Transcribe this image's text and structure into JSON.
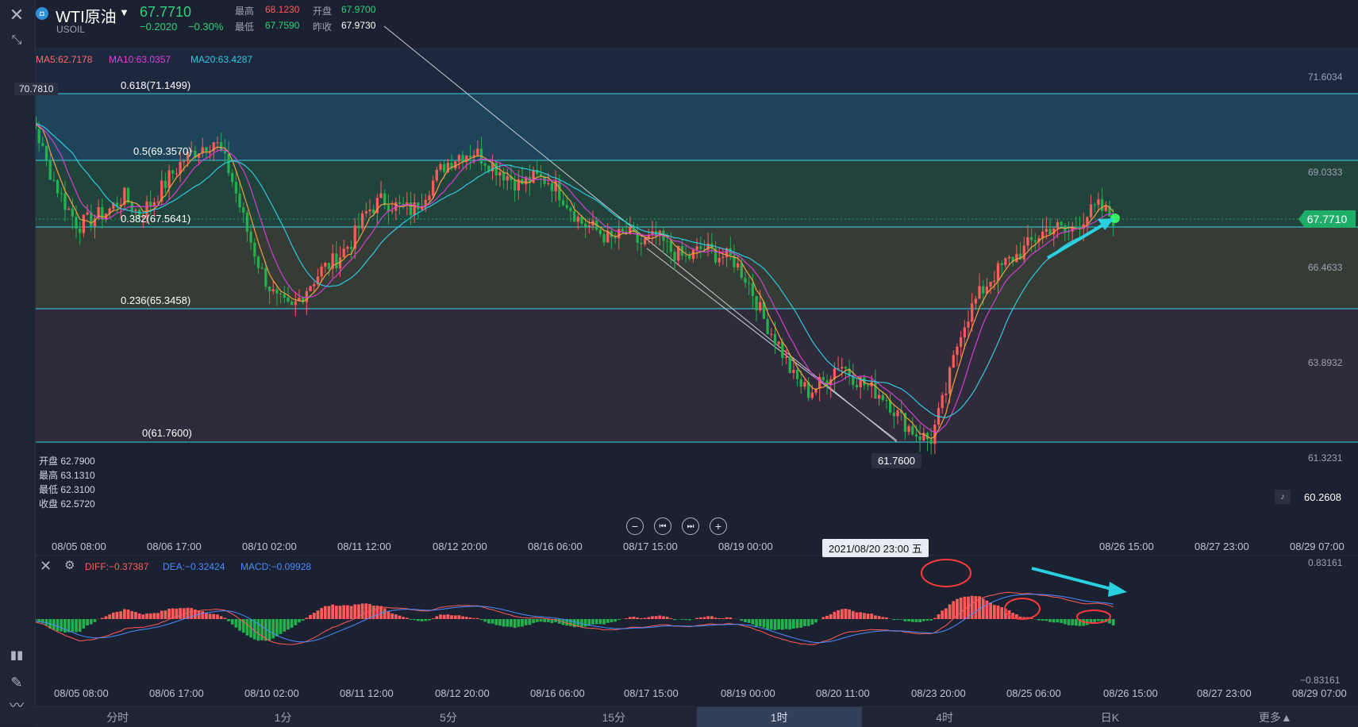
{
  "header": {
    "symbol_name": "WTI原油",
    "symbol_code": "USOIL",
    "last_price": "67.7710",
    "change": "−0.2020",
    "change_pct": "−0.30%",
    "high_label": "最高",
    "high_value": "68.1230",
    "open_label": "开盘",
    "open_value": "67.9700",
    "low_label": "最低",
    "low_value": "67.7590",
    "prev_label": "昨收",
    "prev_value": "67.9730"
  },
  "ma": {
    "ma5": "MA5:62.7178",
    "ma10": "MA10:63.0357",
    "ma20": "MA20:63.4287"
  },
  "fib": [
    {
      "label": "0.618(71.1499)",
      "price": 71.1499
    },
    {
      "label": "0.5(69.3570)",
      "price": 69.357
    },
    {
      "label": "0.382(67.5641)",
      "price": 67.5641
    },
    {
      "label": "0.236(65.3458)",
      "price": 65.3458
    },
    {
      "label": "0(61.7600)",
      "price": 61.76
    }
  ],
  "price_axis": [
    "71.6034",
    "69.0333",
    "66.4633",
    "63.8932",
    "61.3231",
    "60.2608"
  ],
  "top_left_value": "70.7810",
  "current_price_tag": "67.7710",
  "low_marker": "61.7600",
  "ohlc_box": {
    "open": "开盘 62.7900",
    "high": "最高 63.1310",
    "low": "最低 62.3100",
    "close": "收盘 62.5720"
  },
  "time_axis": [
    "08/05 08:00",
    "08/06 17:00",
    "08/10 02:00",
    "08/11 12:00",
    "08/12 20:00",
    "08/16 06:00",
    "08/17 15:00",
    "08/19 00:00",
    "08/20 11:00",
    "08/23 20:00",
    "08/25 06:00",
    "08/26 15:00",
    "08/27 23:00",
    "08/29 07:00"
  ],
  "crosshair_time": "2021/08/20 23:00 五",
  "macd": {
    "diff": "DIFF:−0.37387",
    "dea": "DEA:−0.32424",
    "macd": "MACD:−0.09928",
    "axis_top": "0.83161",
    "axis_bottom": "−0.83161"
  },
  "tabs": [
    "分时",
    "1分",
    "5分",
    "15分",
    "1时",
    "4时",
    "日K",
    "更多▲"
  ],
  "colors": {
    "up": "#ff5b5b",
    "down": "#22b14c",
    "ma5": "#f0a040",
    "ma10": "#d040d0",
    "ma20": "#30c8e0",
    "fib_line": "#3ad0e8",
    "arrow": "#2ad0e0"
  },
  "chart_data": {
    "type": "candlestick",
    "y_range": [
      60.2608,
      72.4
    ],
    "closes": [
      70.7,
      70.2,
      70.5,
      69.2,
      68.3,
      67.6,
      67.8,
      68.0,
      68.4,
      67.9,
      68.3,
      68.9,
      69.4,
      69.7,
      69.9,
      69.0,
      67.6,
      66.4,
      65.6,
      65.3,
      65.9,
      66.4,
      66.7,
      67.2,
      68.0,
      68.3,
      68.1,
      68.0,
      68.6,
      69.2,
      69.5,
      69.6,
      69.3,
      69.0,
      68.7,
      68.9,
      68.8,
      68.3,
      67.7,
      67.5,
      67.2,
      67.4,
      67.1,
      67.3,
      66.9,
      66.7,
      67.0,
      66.8,
      66.7,
      66.1,
      65.1,
      64.4,
      63.5,
      63.1,
      63.4,
      63.9,
      63.5,
      63.2,
      63.0,
      62.4,
      62.0,
      61.8,
      63.1,
      64.8,
      65.6,
      66.2,
      66.6,
      66.9,
      67.3,
      67.6,
      67.4,
      67.8,
      68.1,
      67.8
    ],
    "series": [
      {
        "name": "MA5"
      },
      {
        "name": "MA10"
      },
      {
        "name": "MA20"
      }
    ]
  }
}
